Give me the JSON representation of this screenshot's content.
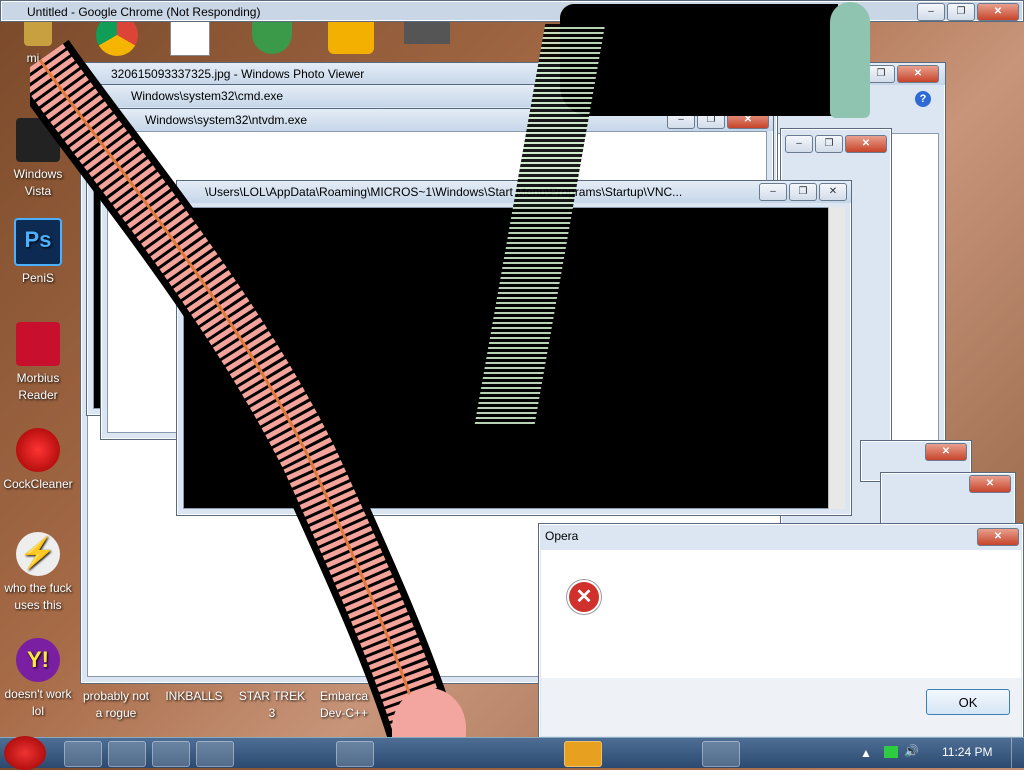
{
  "chrome_window": {
    "title": "Untitled - Google Chrome (Not Responding)"
  },
  "photo_viewer": {
    "title": "320615093337325.jpg - Windows Photo Viewer"
  },
  "cmd_window": {
    "title": "Windows\\system32\\cmd.exe"
  },
  "ntvdm_window": {
    "title": "Windows\\system32\\ntvdm.exe"
  },
  "vnc_window": {
    "title": "\\Users\\LOL\\AppData\\Roaming\\MICROS~1\\Windows\\Start Menu\\Programs\\Startup\\VNC..."
  },
  "desktop_icons": [
    {
      "label": "mi...",
      "icon": "program-icon"
    },
    {
      "label": "Windows Vista",
      "icon": "windows-vista-icon"
    },
    {
      "label": "PeniS",
      "icon": "photoshop-icon"
    },
    {
      "label": "Morbius Reader",
      "icon": "pdf-reader-icon"
    },
    {
      "label": "CockCleaner",
      "icon": "ccleaner-icon"
    },
    {
      "label": "who the fuck uses this",
      "icon": "winamp-icon"
    },
    {
      "label": "doesn't work lol",
      "icon": "yahoo-messenger-icon"
    },
    {
      "label": "probably not a rogue",
      "icon": "shield-icon"
    },
    {
      "label": "INKBALLS",
      "icon": "game-icon"
    },
    {
      "label": "STAR TREK 3",
      "icon": "game-icon"
    },
    {
      "label": "Embarca Dev-C++",
      "icon": "ide-icon"
    }
  ],
  "opera_dialog": {
    "title": "Opera",
    "ok_label": "OK",
    "icon": "error-icon"
  },
  "taskbar": {
    "clock": "11:24 PM"
  },
  "colors": {
    "accent": "#2c4a70",
    "error": "#d0312d"
  }
}
